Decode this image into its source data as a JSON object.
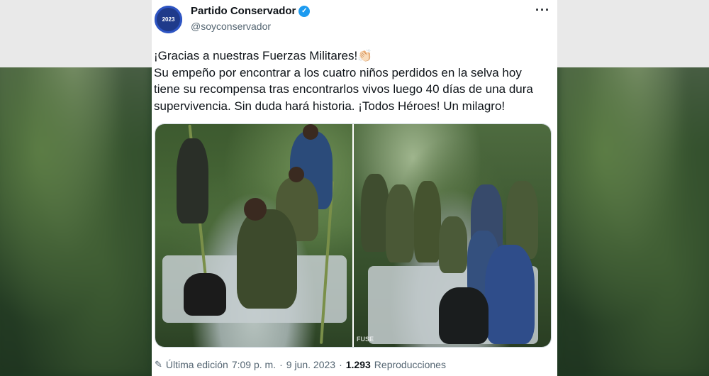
{
  "author": {
    "avatar_text": "2023",
    "display_name": "Partido Conservador",
    "handle": "@soyconservador"
  },
  "tweet": {
    "line1": "¡Gracias a nuestras Fuerzas Militares!👏🏻",
    "line2": "Su empeño por encontrar a los cuatro niños perdidos en la selva hoy tiene su recompensa tras  encontrarlos vivos luego 40 días de una dura supervivencia. Sin duda hará historia. ¡Todos Héroes! Un milagro!"
  },
  "media": {
    "watermark": "FUSE"
  },
  "meta": {
    "edited_label": "Última edición",
    "time": "7:09 p. m.",
    "separator": "·",
    "date": "9 jun. 2023",
    "separator2": "·",
    "views_count": "1.293",
    "views_label": "Reproducciones"
  },
  "icons": {
    "more": "more-icon",
    "verified": "verified-badge-icon",
    "edit": "pencil-icon"
  }
}
